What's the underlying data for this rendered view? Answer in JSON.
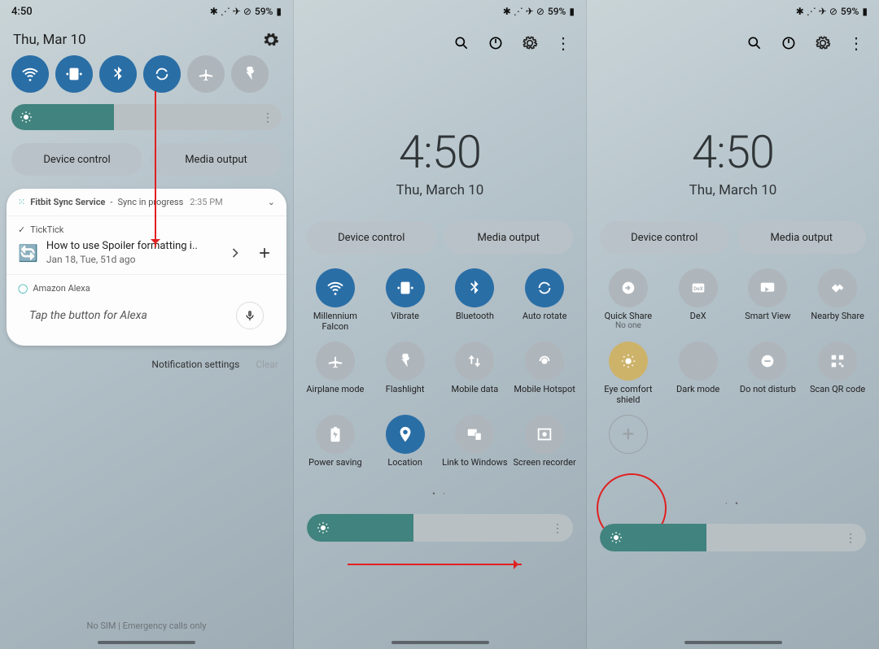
{
  "status": {
    "time": "4:50",
    "battery": "59%"
  },
  "panel1": {
    "date": "Thu, Mar 10",
    "brightness_pct": 38,
    "device_control": "Device control",
    "media_output": "Media output",
    "notif1": {
      "app": "Fitbit Sync Service",
      "title": "Sync in progress",
      "time": "2:35 PM"
    },
    "notif2": {
      "app": "TickTick",
      "title": "How to use Spoiler formatting i..",
      "sub": "Jan 18, Tue, 51d ago"
    },
    "notif3": {
      "app": "Amazon Alexa",
      "prompt": "Tap the button for Alexa"
    },
    "notif_settings": "Notification settings",
    "clear": "Clear",
    "nosim": "No SIM | Emergency calls only"
  },
  "panel2": {
    "clock": "4:50",
    "date": "Thu, March 10",
    "device_control": "Device control",
    "media_output": "Media output",
    "brightness_pct": 40,
    "tiles": [
      {
        "name": "wifi",
        "label": "Millennium Falcon",
        "active": true
      },
      {
        "name": "vibrate",
        "label": "Vibrate",
        "active": true
      },
      {
        "name": "bluetooth",
        "label": "Bluetooth",
        "active": true
      },
      {
        "name": "autorotate",
        "label": "Auto rotate",
        "active": true
      },
      {
        "name": "airplane",
        "label": "Airplane mode",
        "active": false
      },
      {
        "name": "flashlight",
        "label": "Flashlight",
        "active": false
      },
      {
        "name": "mobiledata",
        "label": "Mobile data",
        "active": false
      },
      {
        "name": "hotspot",
        "label": "Mobile Hotspot",
        "active": false
      },
      {
        "name": "powersaving",
        "label": "Power saving",
        "active": false
      },
      {
        "name": "location",
        "label": "Location",
        "active": true
      },
      {
        "name": "linkwindows",
        "label": "Link to Windows",
        "active": false
      },
      {
        "name": "screenrec",
        "label": "Screen recorder",
        "active": false
      }
    ]
  },
  "panel3": {
    "clock": "4:50",
    "date": "Thu, March 10",
    "device_control": "Device control",
    "media_output": "Media output",
    "tiles": [
      {
        "name": "quickshare",
        "label": "Quick Share",
        "sub": "No one",
        "active": false
      },
      {
        "name": "dex",
        "label": "DeX",
        "active": false
      },
      {
        "name": "smartview",
        "label": "Smart View",
        "active": false
      },
      {
        "name": "nearbyshare",
        "label": "Nearby Share",
        "active": false
      },
      {
        "name": "eyecomfort",
        "label": "Eye comfort shield",
        "active": true,
        "eye": true
      },
      {
        "name": "darkmode",
        "label": "Dark mode",
        "active": false
      },
      {
        "name": "dnd",
        "label": "Do not disturb",
        "active": false
      },
      {
        "name": "scanqr",
        "label": "Scan QR code",
        "active": false
      }
    ]
  }
}
